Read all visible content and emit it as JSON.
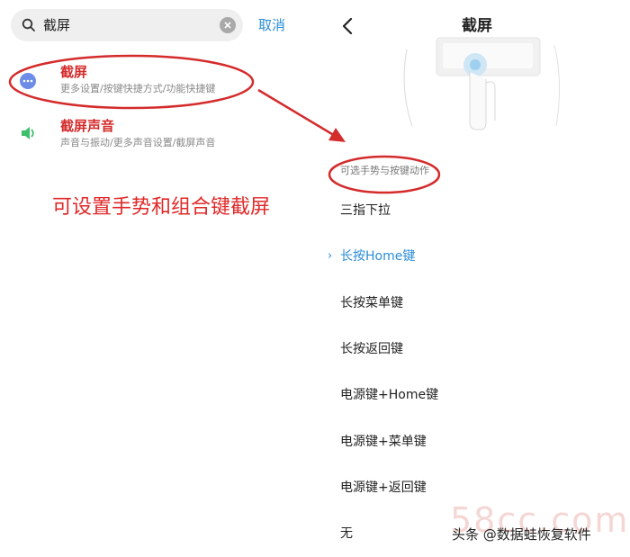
{
  "search": {
    "query": "截屏",
    "cancel_label": "取消"
  },
  "results": [
    {
      "title": "截屏",
      "subtitle": "更多设置/按键快捷方式/功能快捷键"
    },
    {
      "title": "截屏声音",
      "subtitle": "声音与振动/更多声音设置/截屏声音"
    }
  ],
  "annotation": {
    "text": "可设置手势和组合键截屏",
    "color": "#e02828"
  },
  "detail": {
    "title": "截屏",
    "section_header": "可选手势与按键动作",
    "options": [
      {
        "label": "三指下拉",
        "selected": false
      },
      {
        "label": "长按Home键",
        "selected": true
      },
      {
        "label": "长按菜单键",
        "selected": false
      },
      {
        "label": "长按返回键",
        "selected": false
      },
      {
        "label": "电源键+Home键",
        "selected": false
      },
      {
        "label": "电源键+菜单键",
        "selected": false
      },
      {
        "label": "电源键+返回键",
        "selected": false
      },
      {
        "label": "无",
        "selected": false
      }
    ],
    "selected_marker": "›"
  },
  "watermark": {
    "faint_text": "58cc.com",
    "text": "头条 @数据蛙恢复软件"
  },
  "colors": {
    "accent": "#2a8cd8",
    "highlight": "#d42b2b"
  }
}
